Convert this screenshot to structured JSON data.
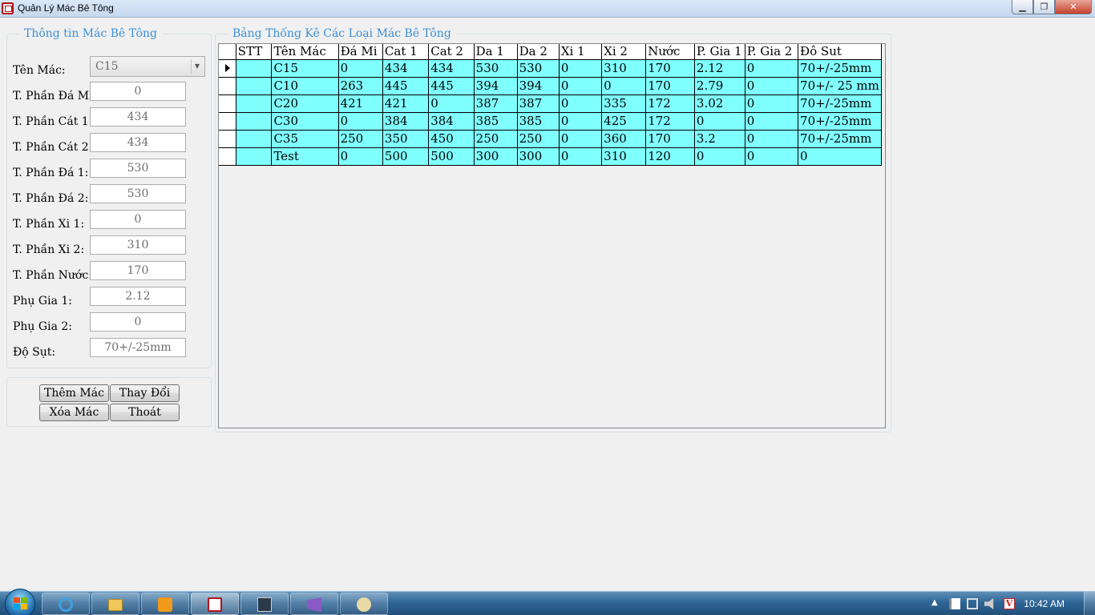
{
  "window": {
    "title": "Quản Lý Mác Bê Tông"
  },
  "info_panel": {
    "title": "Thông tin Mác Bê Tông",
    "fields": [
      {
        "label": "Tên Mác:",
        "value": "C15"
      },
      {
        "label": "T. Phần Đá Mi:",
        "value": "0"
      },
      {
        "label": "T. Phần Cát 1:",
        "value": "434"
      },
      {
        "label": "T. Phần Cát 2:",
        "value": "434"
      },
      {
        "label": "T. Phần Đá 1:",
        "value": "530"
      },
      {
        "label": "T. Phần Đá 2:",
        "value": "530"
      },
      {
        "label": "T. Phần Xi 1:",
        "value": "0"
      },
      {
        "label": "T. Phần Xi 2:",
        "value": "310"
      },
      {
        "label": "T. Phần Nước:",
        "value": "170"
      },
      {
        "label": "Phụ Gia 1:",
        "value": "2.12"
      },
      {
        "label": "Phụ Gia 2:",
        "value": "0"
      },
      {
        "label": "Độ Sụt:",
        "value": "70+/-25mm"
      }
    ]
  },
  "buttons": {
    "add": "Thêm Mác",
    "edit": "Thay Đổi",
    "delete": "Xóa Mác",
    "exit": "Thoát"
  },
  "table_panel": {
    "title": "Bảng Thống Kê Các Loại Mác Bê Tông",
    "columns": [
      "STT",
      "Tên Mác",
      "Đá Mi",
      "Cat 1",
      "Cat 2",
      "Da 1",
      "Da 2",
      "Xi 1",
      "Xi 2",
      "Nước",
      "P. Gia 1",
      "P. Gia 2",
      "Đô Sut"
    ],
    "rows": [
      [
        "",
        "C15",
        "0",
        "434",
        "434",
        "530",
        "530",
        "0",
        "310",
        "170",
        "2.12",
        "0",
        "70+/-25mm"
      ],
      [
        "",
        "C10",
        "263",
        "445",
        "445",
        "394",
        "394",
        "0",
        "0",
        "170",
        "2.79",
        "0",
        "70+/- 25 mm"
      ],
      [
        "",
        "C20",
        "421",
        "421",
        "0",
        "387",
        "387",
        "0",
        "335",
        "172",
        "3.02",
        "0",
        "70+/-25mm"
      ],
      [
        "",
        "C30",
        "0",
        "384",
        "384",
        "385",
        "385",
        "0",
        "425",
        "172",
        "0",
        "0",
        "70+/-25mm"
      ],
      [
        "",
        "C35",
        "250",
        "350",
        "450",
        "250",
        "250",
        "0",
        "360",
        "170",
        "3.2",
        "0",
        "70+/-25mm"
      ],
      [
        "",
        "Test",
        "0",
        "500",
        "500",
        "300",
        "300",
        "0",
        "310",
        "120",
        "0",
        "0",
        "0"
      ]
    ]
  },
  "taskbar": {
    "clock": "10:42 AM"
  },
  "colors": {
    "grid_row": "#80ffff",
    "group_title": "#3b8fd6"
  }
}
